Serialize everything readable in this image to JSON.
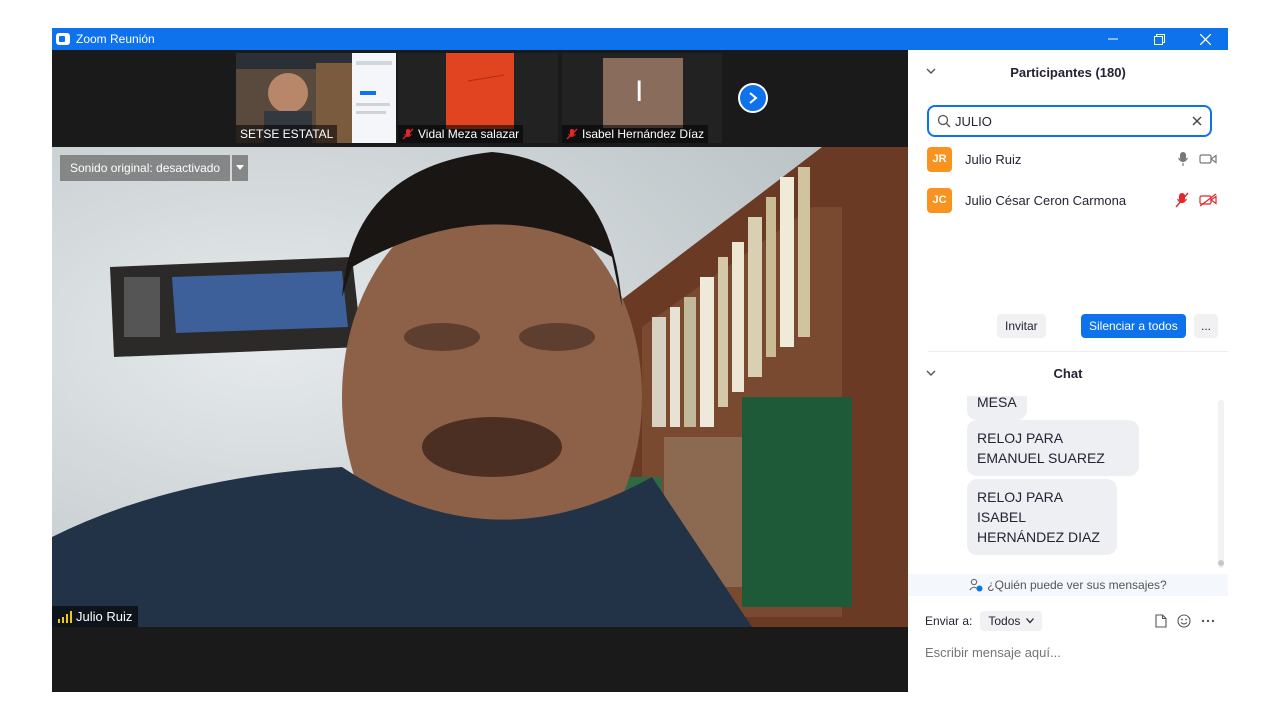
{
  "window": {
    "title": "Zoom Reunión",
    "controls": [
      "minimize-icon",
      "restore-icon",
      "close-icon"
    ]
  },
  "thumbnails": [
    {
      "name": "SETSE ESTATAL",
      "muted": false
    },
    {
      "name": "Vidal Meza salazar",
      "muted": true
    },
    {
      "name": "Isabel Hernández Díaz",
      "muted": true,
      "avatar_letter": "I"
    }
  ],
  "main_video": {
    "original_sound_label": "Sonido original: desactivado",
    "speaker_name": "Julio Ruiz"
  },
  "participants": {
    "header": "Participantes (180)",
    "search_value": "JULIO",
    "list": [
      {
        "initials": "JR",
        "name": "Julio Ruiz",
        "mic_muted": false,
        "video_off": false
      },
      {
        "initials": "JC",
        "name": "Julio César Ceron Carmona",
        "mic_muted": true,
        "video_off": true
      }
    ],
    "invite_label": "Invitar",
    "mute_all_label": "Silenciar a todos",
    "more_label": "..."
  },
  "chat": {
    "header": "Chat",
    "messages": [
      {
        "text": "MESA"
      },
      {
        "text": "RELOJ PARA EMANUEL SUAREZ"
      },
      {
        "text": "RELOJ PARA ISABEL HERNÁNDEZ DIAZ"
      }
    ],
    "who_can_see": "¿Quién puede ver sus mensajes?",
    "send_to_label": "Enviar a:",
    "send_to_value": "Todos",
    "input_placeholder": "Escribir mensaje aquí..."
  },
  "colors": {
    "accent": "#0e72ed",
    "avatar": "#f7931e",
    "muted_red": "#e02828"
  }
}
